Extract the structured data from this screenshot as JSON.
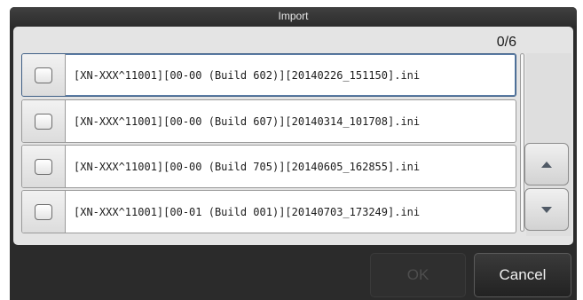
{
  "dialog": {
    "title": "Import",
    "counter": "0/6",
    "files": [
      {
        "name": "[XN-XXX^11001][00-00 (Build 602)][20140226_151150].ini",
        "checked": false
      },
      {
        "name": "[XN-XXX^11001][00-00 (Build 607)][20140314_101708].ini",
        "checked": false
      },
      {
        "name": "[XN-XXX^11001][00-00 (Build 705)][20140605_162855].ini",
        "checked": false
      },
      {
        "name": "[XN-XXX^11001][00-01 (Build 001)][20140703_173249].ini",
        "checked": false
      }
    ],
    "ok_label": "OK",
    "cancel_label": "Cancel"
  },
  "icons": {
    "scroll_up": "triangle-up-icon",
    "scroll_down": "triangle-down-icon"
  },
  "colors": {
    "selected_border": "#3f5f86",
    "dialog_background": "#2b2b2b"
  }
}
